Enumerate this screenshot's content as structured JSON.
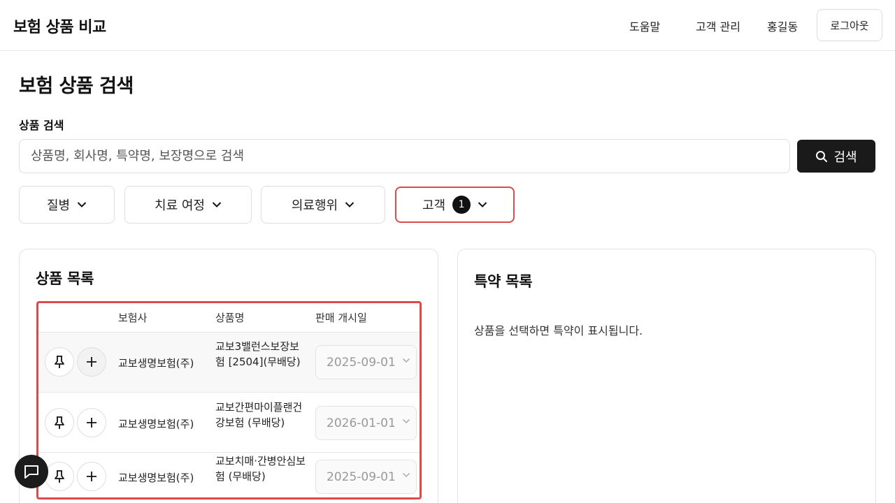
{
  "app": {
    "title": "보험 상품 비교"
  },
  "nav": {
    "help": "도움말",
    "customers": "고객 관리",
    "user": "홍길동",
    "logout": "로그아웃"
  },
  "page": {
    "title": "보험 상품 검색"
  },
  "search": {
    "label": "상품 검색",
    "placeholder": "상품명, 회사명, 특약명, 보장명으로 검색",
    "button": "검색"
  },
  "filters": [
    {
      "label": "질병"
    },
    {
      "label": "치료 여정"
    },
    {
      "label": "의료행위"
    },
    {
      "label": "고객",
      "badge": "1"
    }
  ],
  "products": {
    "title": "상품 목록",
    "columns": [
      "보험사",
      "상품명",
      "판매 개시일"
    ],
    "rows": [
      {
        "company": "교보생명보험(주)",
        "name": "교보3밸런스보장보험 [2504](무배당)",
        "date": "2025-09-01"
      },
      {
        "company": "교보생명보험(주)",
        "name": "교보간편마이플랜건강보험 (무배당)",
        "date": "2026-01-01"
      },
      {
        "company": "교보생명보험(주)",
        "name": "교보치매·간병안심보험 (무배당)",
        "date": "2025-09-01"
      }
    ]
  },
  "riders": {
    "title": "특약 목록",
    "empty": "상품을 선택하면 특약이 표시됩니다."
  },
  "icons": {
    "search": "search-icon",
    "chevron": "chevron-down-icon",
    "pin": "pin-icon",
    "plus": "plus-icon",
    "chat": "chat-icon"
  }
}
